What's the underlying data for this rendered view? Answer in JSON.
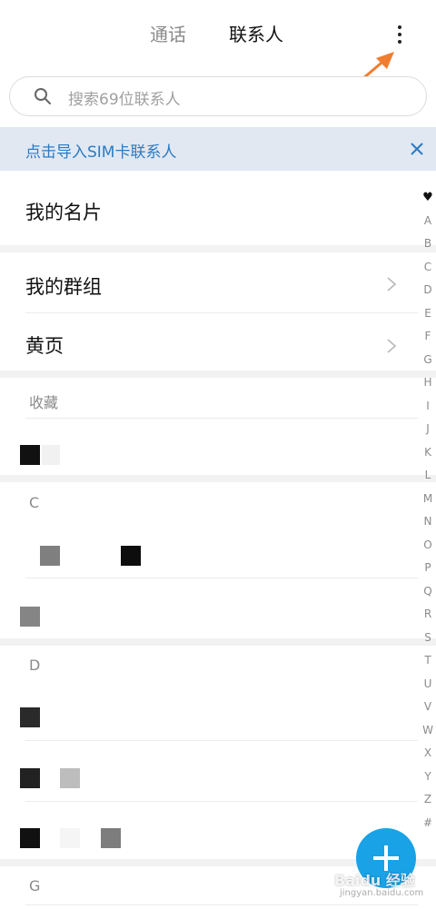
{
  "tabs": {
    "calls": "通话",
    "contacts": "联系人"
  },
  "search": {
    "placeholder": "搜索69位联系人"
  },
  "banner": {
    "text": "点击导入SIM卡联系人"
  },
  "menu": {
    "my_card": "我的名片",
    "my_groups": "我的群组",
    "yellow_pages": "黄页"
  },
  "sections": {
    "favorites": "收藏",
    "c": "C",
    "d": "D",
    "g": "G"
  },
  "index": [
    "♥",
    "A",
    "B",
    "C",
    "D",
    "E",
    "F",
    "G",
    "H",
    "I",
    "J",
    "K",
    "L",
    "M",
    "N",
    "O",
    "P",
    "Q",
    "R",
    "S",
    "T",
    "U",
    "V",
    "W",
    "X",
    "Y",
    "Z",
    "#"
  ],
  "watermark": {
    "main": "Baidu 经验",
    "sub": "jingyan.baidu.com"
  },
  "colors": {
    "accent": "#1aa2e6",
    "banner_bg": "#e1e8f2",
    "banner_text": "#2a7bc4",
    "arrow": "#f07e30"
  }
}
